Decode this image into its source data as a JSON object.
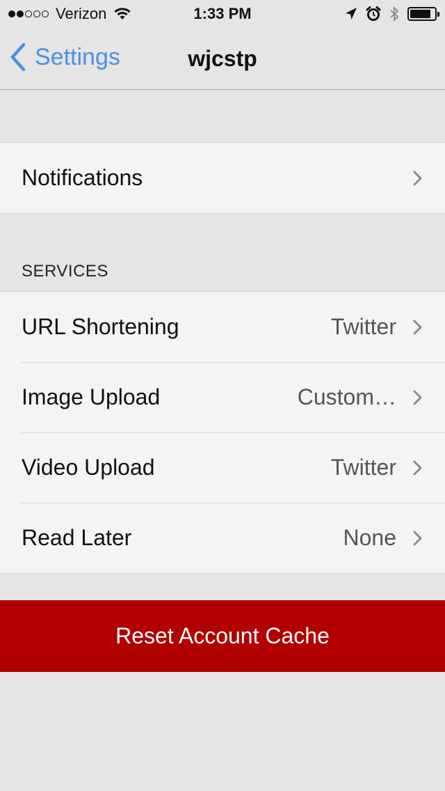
{
  "status_bar": {
    "signal_filled": 2,
    "signal_total": 5,
    "carrier": "Verizon",
    "time": "1:33 PM",
    "icons": [
      "wifi-icon",
      "location-icon",
      "alarm-icon",
      "bluetooth-icon",
      "battery-icon"
    ],
    "battery_level": 0.85
  },
  "nav": {
    "back_label": "Settings",
    "title": "wjcstp",
    "accent_color": "#4a90e2"
  },
  "general": {
    "rows": [
      {
        "label": "Notifications",
        "value": ""
      }
    ]
  },
  "services": {
    "header": "SERVICES",
    "rows": [
      {
        "label": "URL Shortening",
        "value": "Twitter"
      },
      {
        "label": "Image Upload",
        "value": "Custom…"
      },
      {
        "label": "Video Upload",
        "value": "Twitter"
      },
      {
        "label": "Read Later",
        "value": "None"
      }
    ]
  },
  "reset": {
    "label": "Reset Account Cache",
    "color": "#b20000"
  }
}
